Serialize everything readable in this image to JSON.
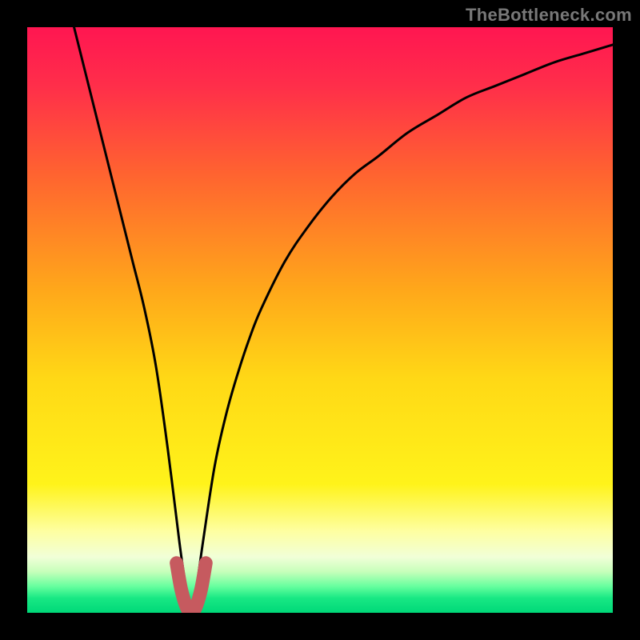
{
  "watermark": "TheBottleneck.com",
  "colors": {
    "frame": "#000000",
    "watermark": "#787878",
    "curve": "#000000",
    "highlight": "#c65a5f",
    "gradient_stops": [
      {
        "offset": 0.0,
        "color": "#ff1651"
      },
      {
        "offset": 0.1,
        "color": "#ff2e4a"
      },
      {
        "offset": 0.25,
        "color": "#ff6330"
      },
      {
        "offset": 0.45,
        "color": "#ffa81a"
      },
      {
        "offset": 0.6,
        "color": "#ffd816"
      },
      {
        "offset": 0.78,
        "color": "#fff31a"
      },
      {
        "offset": 0.86,
        "color": "#feffa0"
      },
      {
        "offset": 0.905,
        "color": "#f1ffd8"
      },
      {
        "offset": 0.93,
        "color": "#c6ffba"
      },
      {
        "offset": 0.955,
        "color": "#66ff9e"
      },
      {
        "offset": 0.975,
        "color": "#18e884"
      },
      {
        "offset": 1.0,
        "color": "#00d878"
      }
    ]
  },
  "chart_data": {
    "type": "line",
    "title": "",
    "xlabel": "",
    "ylabel": "",
    "xlim": [
      0,
      100
    ],
    "ylim": [
      0,
      100
    ],
    "grid": false,
    "series": [
      {
        "name": "bottleneck-curve",
        "x": [
          8,
          10,
          12,
          14,
          16,
          18,
          20,
          22,
          24,
          26,
          27,
          28,
          29,
          30,
          32,
          34,
          36,
          38,
          40,
          44,
          48,
          52,
          56,
          60,
          65,
          70,
          75,
          80,
          85,
          90,
          95,
          100
        ],
        "values": [
          100,
          92,
          84,
          76,
          68,
          60,
          52,
          42,
          28,
          12,
          5,
          0,
          5,
          12,
          25,
          34,
          41,
          47,
          52,
          60,
          66,
          71,
          75,
          78,
          82,
          85,
          88,
          90,
          92,
          94,
          95.5,
          97
        ]
      }
    ],
    "annotations": [
      {
        "name": "optimal-region-highlight",
        "x": [
          25.5,
          26.3,
          27.2,
          28.0,
          28.8,
          29.7,
          30.5
        ],
        "values": [
          8.5,
          4.0,
          1.0,
          0.0,
          1.0,
          4.0,
          8.5
        ]
      }
    ]
  }
}
